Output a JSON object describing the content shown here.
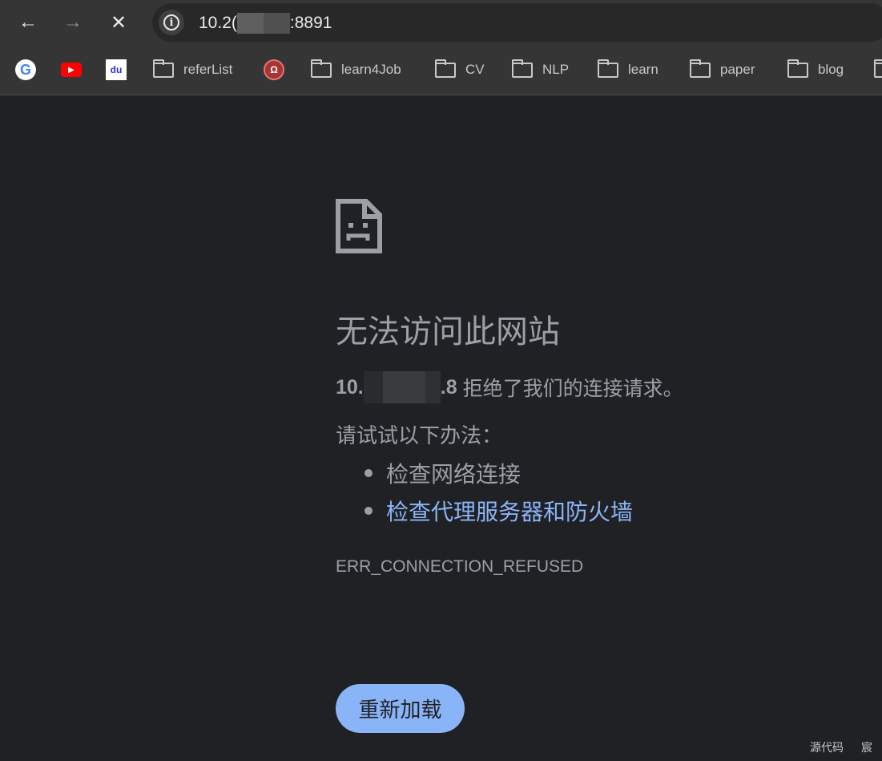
{
  "browser": {
    "url_prefix": "10.2(",
    "url_suffix": ":8891",
    "bookmarks": [
      {
        "type": "favicon",
        "icon": "google-icon"
      },
      {
        "type": "favicon",
        "icon": "youtube-icon"
      },
      {
        "type": "favicon",
        "icon": "baidu-icon"
      },
      {
        "type": "folder",
        "label": "referList"
      },
      {
        "type": "favicon",
        "icon": "railway-icon"
      },
      {
        "type": "folder",
        "label": "learn4Job"
      },
      {
        "type": "folder",
        "label": "CV"
      },
      {
        "type": "folder",
        "label": "NLP"
      },
      {
        "type": "folder",
        "label": "learn"
      },
      {
        "type": "folder",
        "label": "paper"
      },
      {
        "type": "folder",
        "label": "blog"
      }
    ]
  },
  "error": {
    "title": "无法访问此网站",
    "host_prefix": "10.",
    "host_suffix": ".8",
    "message": "拒绝了我们的连接请求。",
    "try_label": "请试试以下办法：",
    "suggestions": [
      "检查网络连接",
      "检查代理服务器和防火墙"
    ],
    "code": "ERR_CONNECTION_REFUSED",
    "reload_label": "重新加载"
  },
  "footer": {
    "source": "源代码",
    "extra": "宸"
  },
  "colors": {
    "accent": "#8ab4f8",
    "background": "#202124"
  }
}
